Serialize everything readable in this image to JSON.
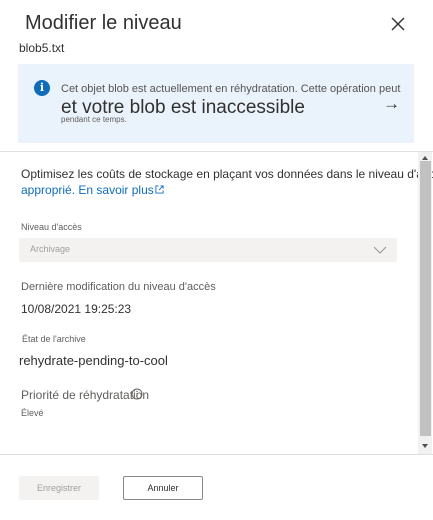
{
  "header": {
    "title": "Modifier le niveau",
    "subtitle": "blob5.txt"
  },
  "banner": {
    "icon": "info-icon",
    "line1": "Cet objet blob est actuellement en réhydratation. Cette opération peut",
    "line2": "et votre blob est inaccessible",
    "line3": "pendant ce temps."
  },
  "description": {
    "line1": "Optimisez les coûts de stockage en plaçant vos données dans le niveau d'accès",
    "line2_text": "approprié.",
    "link": "En savoir plus"
  },
  "access_tier": {
    "label": "Niveau d'accès",
    "value": "Archivage"
  },
  "last_modified": {
    "label": "Dernière modification du niveau d'accès",
    "value": "10/08/2021 19:25:23"
  },
  "archive_state": {
    "label": "État de l'archive",
    "value": "rehydrate-pending-to-cool"
  },
  "rehydration_priority": {
    "label": "Priorité de réhydratation",
    "value": "Élevé"
  },
  "footer": {
    "save_label": "Enregistrer",
    "cancel_label": "Annuler"
  },
  "colors": {
    "accent": "#0f6cbd",
    "banner_bg": "#eaf3fc",
    "disabled_bg": "#f3f2f1"
  }
}
